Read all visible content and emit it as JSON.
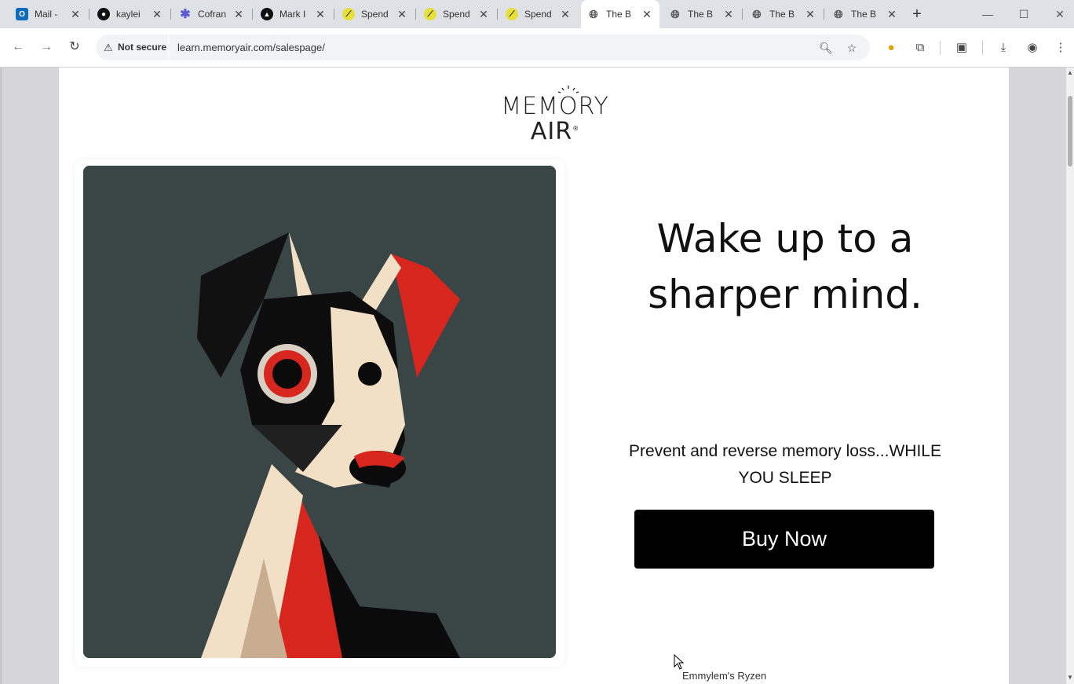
{
  "browser": {
    "tabs": [
      {
        "title": "Mail -",
        "favicon": "outlook-icon",
        "color": "#0f6cbd"
      },
      {
        "title": "kaylei",
        "favicon": "github-icon",
        "color": "#111111"
      },
      {
        "title": "Cofran",
        "favicon": "asterisk-icon",
        "color": "#5b5bd6"
      },
      {
        "title": "Mark I",
        "favicon": "triangle-logo-icon",
        "color": "#111111"
      },
      {
        "title": "Spend",
        "favicon": "spend-icon",
        "color": "#e8e03a"
      },
      {
        "title": "Spend",
        "favicon": "spend-icon",
        "color": "#e8e03a"
      },
      {
        "title": "Spend",
        "favicon": "spend-icon",
        "color": "#e8e03a"
      },
      {
        "title": "The B",
        "favicon": "globe-icon",
        "color": "#555555",
        "active": true
      },
      {
        "title": "The B",
        "favicon": "globe-icon",
        "color": "#555555"
      },
      {
        "title": "The B",
        "favicon": "globe-icon",
        "color": "#555555"
      },
      {
        "title": "The B",
        "favicon": "globe-icon",
        "color": "#555555"
      }
    ],
    "omnibox": {
      "security_label": "Not secure",
      "url": "learn.memoryair.com/salespage/"
    }
  },
  "page": {
    "logo": {
      "line1": "MEMORY",
      "line2": "AIR",
      "mark": "®"
    },
    "headline_line1": "Wake up to a",
    "headline_line2": "sharper mind.",
    "subtext_line1": "Prevent and reverse memory loss...WHILE",
    "subtext_line2": "YOU SLEEP",
    "buy_button": "Buy Now",
    "cursor_tooltip": "Emmylem's Ryzen"
  },
  "colors": {
    "hero_background": "#3a4645",
    "accent_red": "#d7261e",
    "button_bg": "#000000"
  }
}
